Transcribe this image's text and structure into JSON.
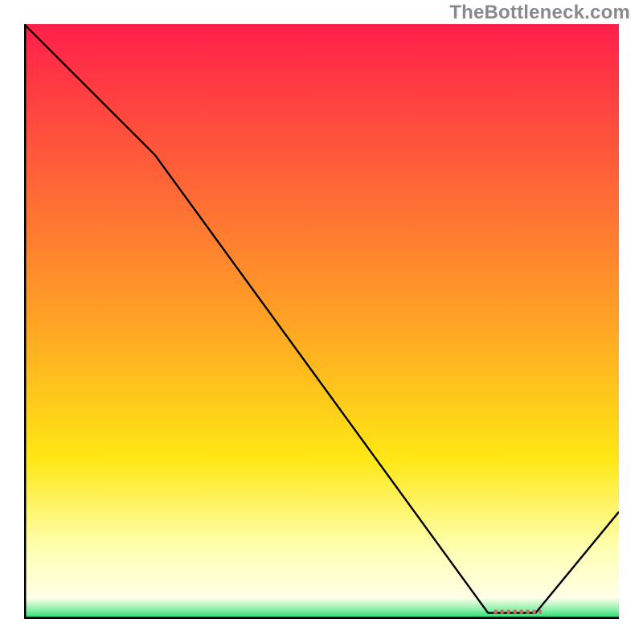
{
  "watermark": "TheBottleneck.com",
  "chart_data": {
    "type": "line",
    "title": "",
    "xlabel": "",
    "ylabel": "",
    "xlim": [
      0,
      100
    ],
    "ylim": [
      0,
      100
    ],
    "x": [
      0,
      22,
      78,
      86,
      100
    ],
    "values": [
      100,
      78,
      1,
      1,
      18
    ],
    "marker": {
      "x0": 79,
      "x1": 87,
      "y": 1.2,
      "color": "#e06060"
    },
    "background_gradient": {
      "stops": [
        {
          "offset": 0.0,
          "color": "#ff1f4a"
        },
        {
          "offset": 0.5,
          "color": "#ffa325"
        },
        {
          "offset": 0.73,
          "color": "#ffe714"
        },
        {
          "offset": 0.88,
          "color": "#feffb0"
        },
        {
          "offset": 0.965,
          "color": "#ffffe8"
        },
        {
          "offset": 0.985,
          "color": "#87f0a8"
        },
        {
          "offset": 1.0,
          "color": "#19d86b"
        }
      ]
    },
    "line_color": "#000000",
    "axis_color": "#000000"
  }
}
